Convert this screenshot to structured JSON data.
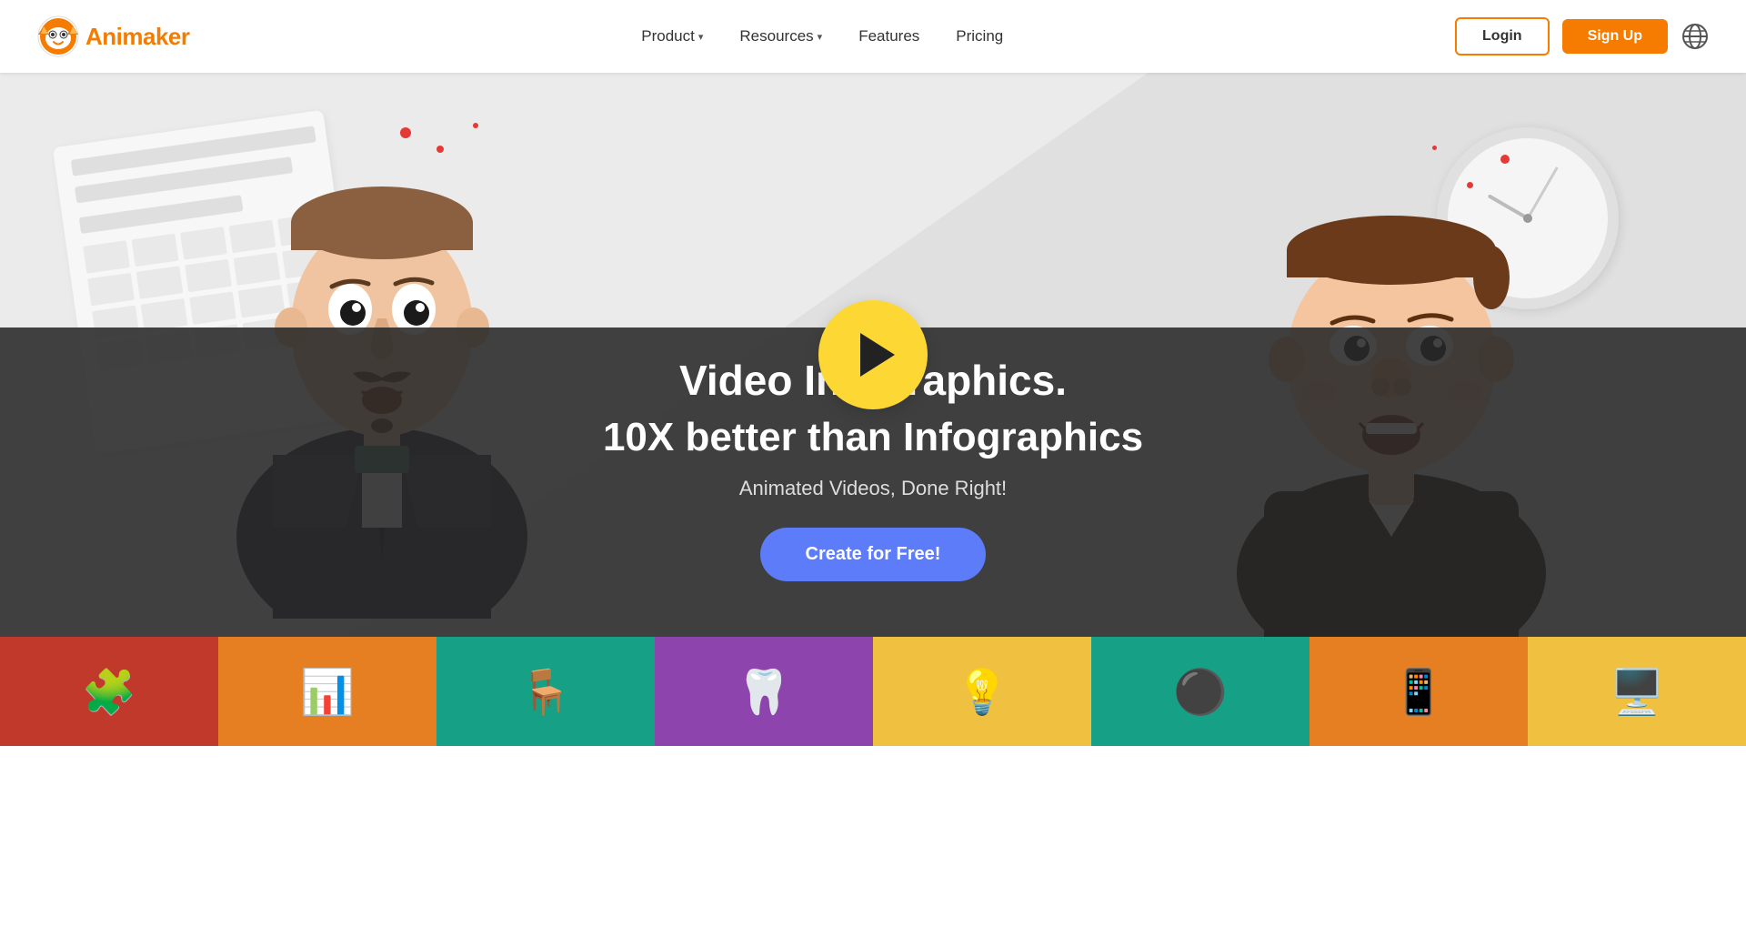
{
  "navbar": {
    "logo_text": "Animaker",
    "nav_items": [
      {
        "label": "Product",
        "has_dropdown": true
      },
      {
        "label": "Resources",
        "has_dropdown": true
      },
      {
        "label": "Features",
        "has_dropdown": false
      },
      {
        "label": "Pricing",
        "has_dropdown": false
      }
    ],
    "login_label": "Login",
    "signup_label": "Sign Up"
  },
  "hero": {
    "title_bold": "Video Infographics.",
    "subtitle": "10X better than Infographics",
    "description": "Animated Videos, Done Right!",
    "cta_label": "Create for Free!"
  },
  "icon_strip": {
    "items": [
      {
        "emoji": "🧩",
        "bg": "#c0392b"
      },
      {
        "emoji": "📊",
        "bg": "#e67e22"
      },
      {
        "emoji": "🪑",
        "bg": "#16a085"
      },
      {
        "emoji": "🦷",
        "bg": "#8e44ad"
      },
      {
        "emoji": "💡",
        "bg": "#f0c040"
      },
      {
        "emoji": "⚫",
        "bg": "#16a085"
      },
      {
        "emoji": "📱",
        "bg": "#e67e22"
      },
      {
        "emoji": "🖥️",
        "bg": "#f0c040"
      }
    ]
  }
}
